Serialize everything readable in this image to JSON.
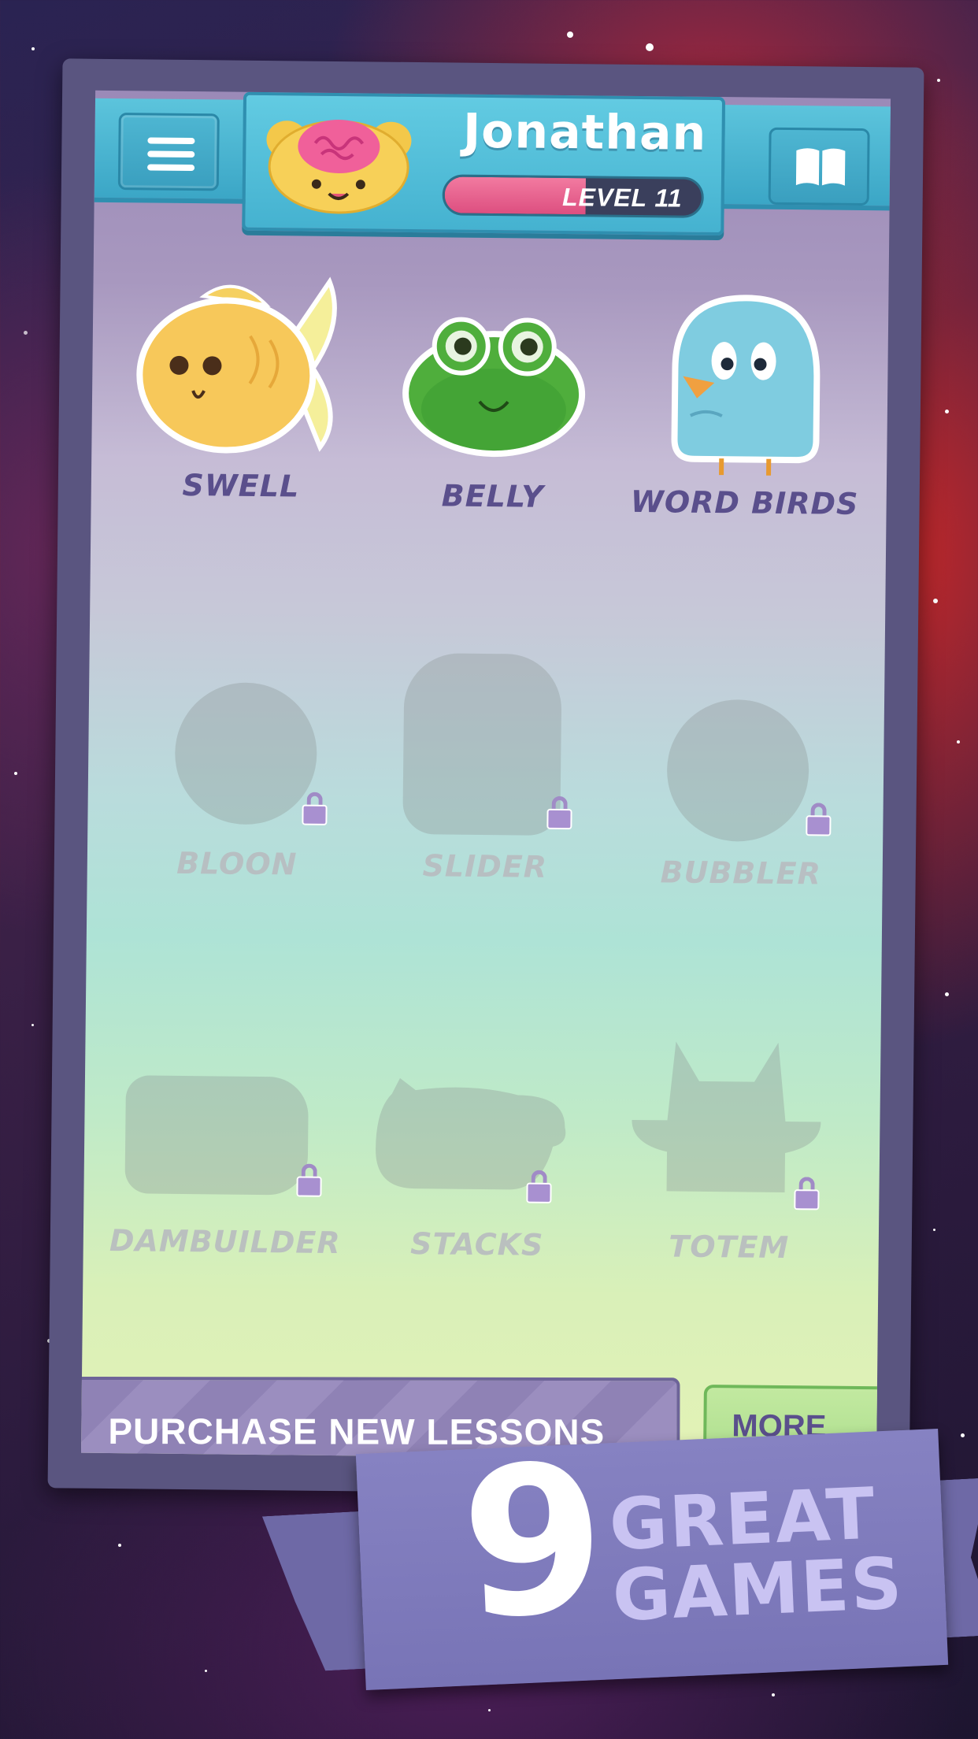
{
  "header": {
    "player_name": "Jonathan",
    "level_label": "LEVEL 11",
    "level_progress_fraction": 0.55,
    "menu_icon": "hamburger-menu-icon",
    "book_icon": "book-icon",
    "avatar_icon": "brain-bear-avatar-icon"
  },
  "games": [
    {
      "label": "SWELL",
      "locked": false,
      "icon": "fish-icon"
    },
    {
      "label": "BELLY",
      "locked": false,
      "icon": "frog-icon"
    },
    {
      "label": "WORD BIRDS",
      "locked": false,
      "icon": "bird-icon"
    },
    {
      "label": "BLOON",
      "locked": true,
      "icon": "balloon-silhouette-icon"
    },
    {
      "label": "SLIDER",
      "locked": true,
      "icon": "blob-silhouette-icon"
    },
    {
      "label": "BUBBLER",
      "locked": true,
      "icon": "bubble-silhouette-icon"
    },
    {
      "label": "DAMBUILDER",
      "locked": true,
      "icon": "log-silhouette-icon"
    },
    {
      "label": "STACKS",
      "locked": true,
      "icon": "cat-silhouette-icon"
    },
    {
      "label": "TOTEM",
      "locked": true,
      "icon": "totem-silhouette-icon"
    }
  ],
  "footer": {
    "purchase_label": "PURCHASE NEW LESSONS",
    "more_label": "MORE"
  },
  "banner": {
    "number": "9",
    "line1": "GREAT",
    "line2": "GAMES"
  },
  "colors": {
    "header_blue": "#45b2d0",
    "label_purple": "#5a4f8c",
    "level_pink": "#dd4f80",
    "banner_purple": "#7874b6"
  }
}
